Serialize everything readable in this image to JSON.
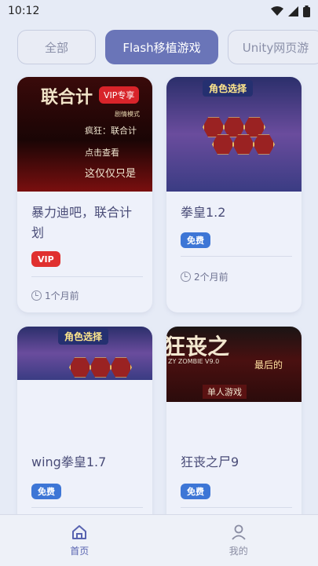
{
  "status": {
    "time": "10:12"
  },
  "tabs": [
    {
      "label": "全部",
      "active": false
    },
    {
      "label": "Flash移植游戏",
      "active": true
    },
    {
      "label": "Unity网页游",
      "active": false
    }
  ],
  "cards": [
    {
      "title": "暴力迪吧，联合计划",
      "badge": "VIP",
      "time": "1个月前",
      "thumb_texts": {
        "main": "联合计",
        "badge": "VIP专享",
        "line1": "剧情模式",
        "line2": "疯狂：联合计",
        "line3": "点击查看",
        "line4": "这仅仅只是"
      }
    },
    {
      "title": "拳皇1.2",
      "badge": "免费",
      "time": "2个月前",
      "thumb_texts": {
        "main": "角色选择"
      }
    },
    {
      "title": "wing拳皇1.7",
      "badge": "免费",
      "time": "",
      "thumb_texts": {
        "main": "角色选择"
      }
    },
    {
      "title": "狂丧之尸9",
      "badge": "免费",
      "time": "",
      "thumb_texts": {
        "main": "狂丧之",
        "sub": "ZY ZOMBIE V9.0",
        "sub2": "最后的",
        "sub3": "单人游戏"
      }
    }
  ],
  "nav": [
    {
      "label": "首页",
      "icon": "home-icon",
      "active": true
    },
    {
      "label": "我的",
      "icon": "user-icon",
      "active": false
    }
  ],
  "colors": {
    "accent": "#6a75b8",
    "vip": "#e0302f",
    "free": "#3d76d6",
    "background": "#e6ebf6"
  }
}
